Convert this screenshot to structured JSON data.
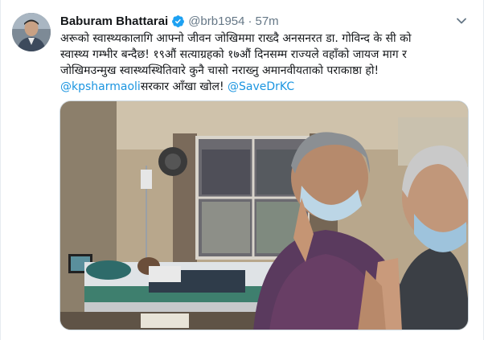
{
  "tweet": {
    "author_name": "Baburam Bhattarai",
    "handle": "@brb1954",
    "separator": "·",
    "timestamp": "57m",
    "text_line_1": "अरूको स्वास्थ्यकालागि आफ्नो जीवन जोखिममा राख्दै अनसनरत डा. गोविन्द के सी को",
    "text_line_2": "स्वास्थ्य गम्भीर बन्दैछ! १९औं सत्याग्रहको १७औं दिनसम्म राज्यले वहाँको जायज माग र",
    "text_line_3": "जोखिमउन्मुख स्वास्थ्यस्थितिवारे कुनै चासो नराख्नु अमानवीयताको पराकाष्ठा हो!",
    "mention_1": "@kpsharmaoli",
    "text_line_4_mid": "सरकार आँखा खोल! ",
    "mention_2": "@SaveDrKC"
  },
  "icons": {
    "verified": "verified-badge-icon",
    "caret": "chevron-down-icon"
  },
  "colors": {
    "link": "#1b95e0",
    "secondary_text": "#657786",
    "verified": "#1da1f2"
  }
}
